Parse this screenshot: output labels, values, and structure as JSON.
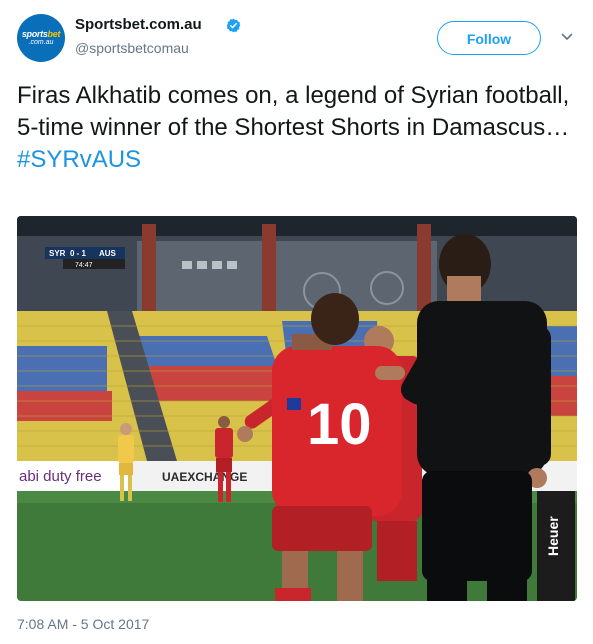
{
  "header": {
    "display_name": "Sportsbet.com.au",
    "handle": "@sportsbetcomau",
    "follow_label": "Follow",
    "avatar_logo_primary": "sports",
    "avatar_logo_accent": "bet",
    "avatar_logo_sub": ".com.au",
    "icons": [
      "verified-icon",
      "chevron-down-icon"
    ]
  },
  "tweet": {
    "text": "Firas Alkhatib comes on, a legend of Syrian football, 5-time winner of the Shortest Shorts in Damascus…",
    "hashtag": "#SYRvAUS",
    "timestamp": "7:08 AM - 5 Oct 2017"
  },
  "media": {
    "scoreboard": {
      "team_home": "SYR",
      "score": "0 - 1",
      "team_away": "AUS",
      "clock": "74:47"
    },
    "player_number": "10",
    "hoardings": [
      "abi duty free",
      "UAEXCHANGE"
    ],
    "watch_brand": "Heuer"
  },
  "colors": {
    "accent": "#1da1f2",
    "hashtag": "#1b95e0",
    "avatar_bg": "#0a6fb9",
    "syria_red": "#d8262c"
  }
}
